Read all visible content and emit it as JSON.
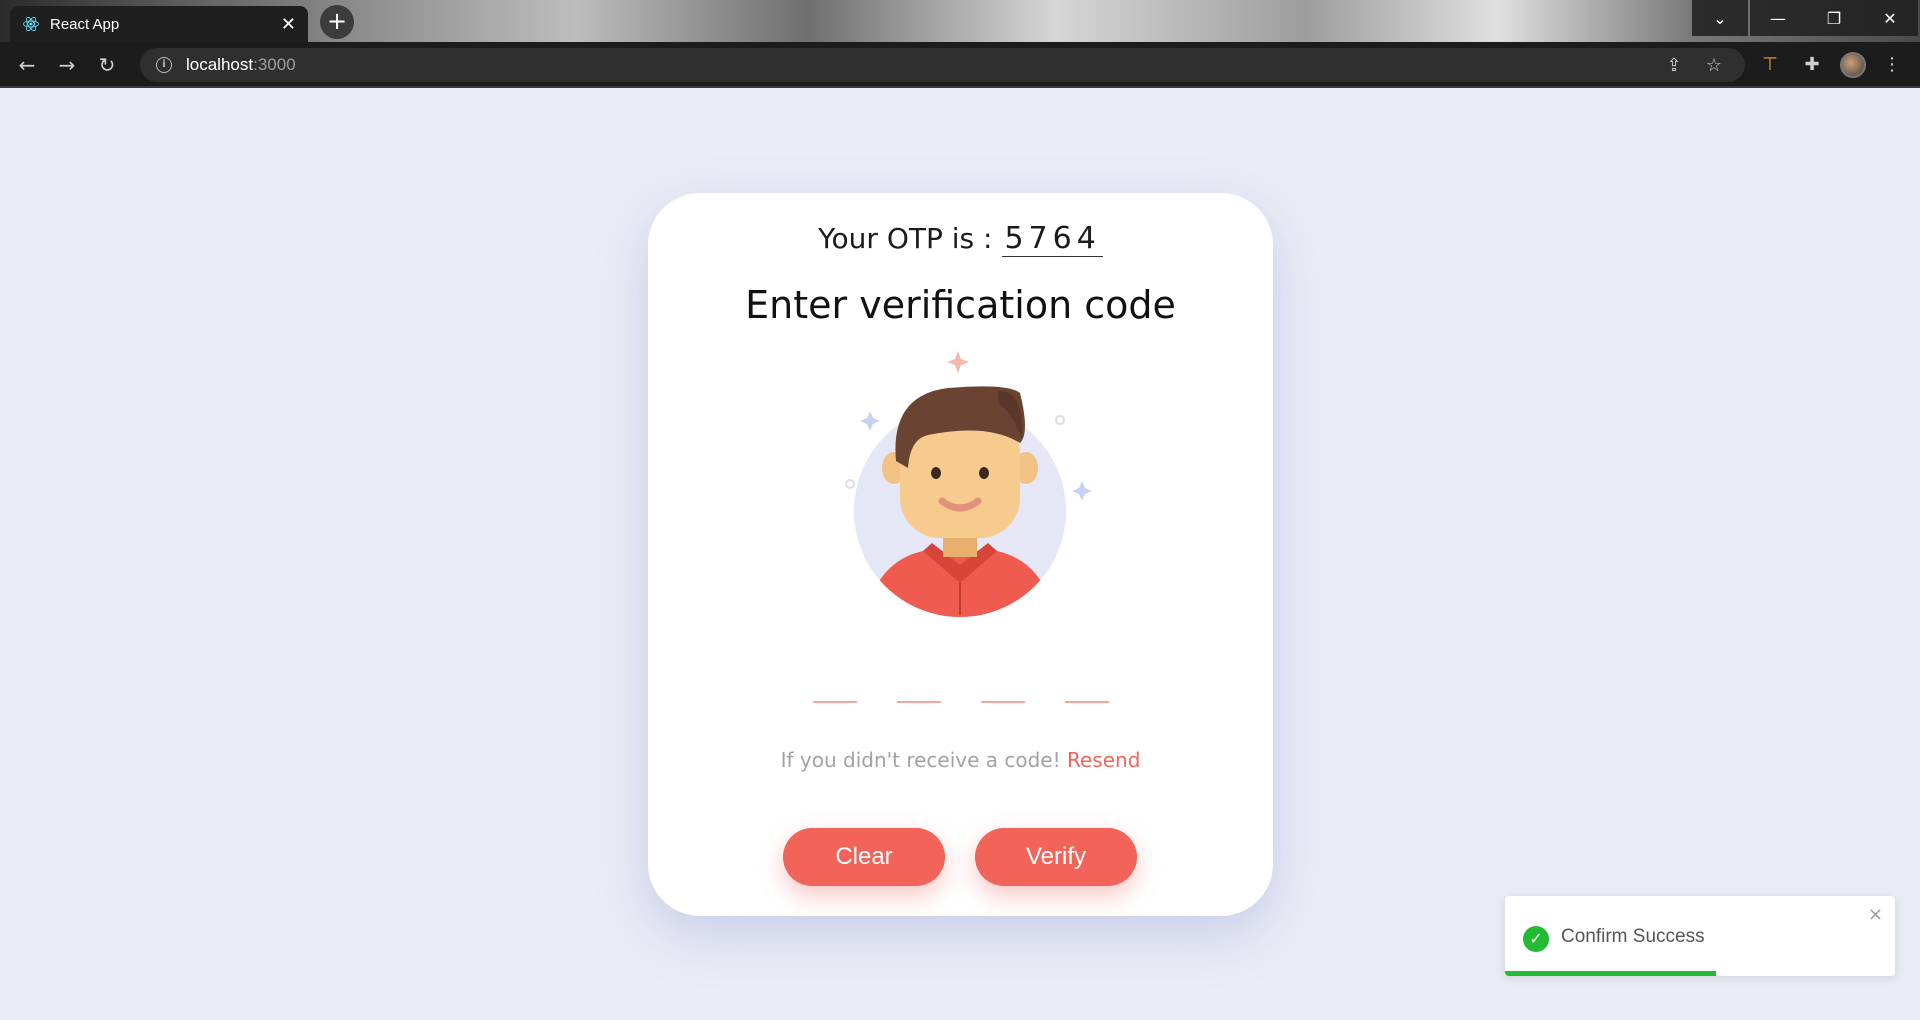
{
  "browser": {
    "tab_title": "React App",
    "new_tab_label": "+",
    "url_host": "localhost",
    "url_port": ":3000"
  },
  "card": {
    "otp_label": "Your OTP is :",
    "otp_value": "5764",
    "heading": "Enter verification code",
    "otp_inputs": [
      "",
      "",
      "",
      ""
    ],
    "resend_text": "If you didn't receive a code!",
    "resend_link": "Resend",
    "clear_label": "Clear",
    "verify_label": "Verify"
  },
  "toast": {
    "message": "Confirm Success",
    "close_label": "×",
    "progress": 0.54
  },
  "colors": {
    "accent": "#f2645a",
    "success": "#22bb33",
    "background": "#e9ecf6"
  },
  "icons": [
    "react-icon",
    "close-icon",
    "plus-icon",
    "back-icon",
    "forward-icon",
    "reload-icon",
    "info-icon",
    "share-icon",
    "star-icon",
    "extension-icon",
    "puzzle-icon",
    "menu-icon",
    "check-icon",
    "chevron-down-icon",
    "minimize-icon",
    "restore-icon"
  ]
}
